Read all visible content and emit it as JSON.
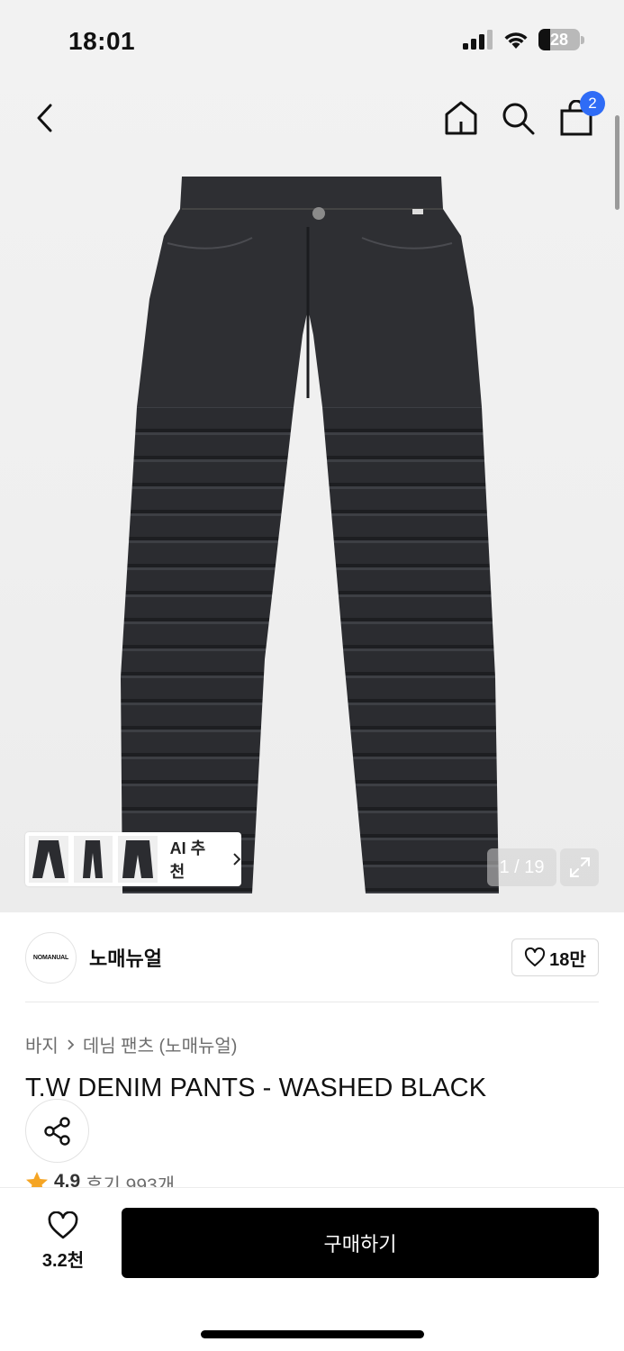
{
  "status_bar": {
    "time": "18:01",
    "battery": "28"
  },
  "nav": {
    "cart_count": "2"
  },
  "gallery": {
    "ai_label": "AI 추천",
    "counter": "1 / 19"
  },
  "brand": {
    "logo_text": "NOMANUAL",
    "name": "노매뉴얼",
    "likes": "18만"
  },
  "breadcrumb": {
    "category": "바지",
    "subcategory": "데님 팬츠 (노매뉴얼)"
  },
  "product": {
    "title": "T.W DENIM PANTS - WASHED BLACK",
    "rating": "4.9",
    "reviews": "후기 993개"
  },
  "bottom_bar": {
    "wish_count": "3.2천",
    "buy_label": "구매하기"
  },
  "colors": {
    "accent_badge": "#2f6cf6",
    "buy_button": "#000000",
    "star": "#f5a524",
    "denim": "#2b2c30"
  },
  "icons": [
    "back-arrow-icon",
    "home-icon",
    "search-icon",
    "bag-icon",
    "chevron-right-icon",
    "expand-icon",
    "heart-icon",
    "share-icon",
    "star-icon",
    "signal-icon",
    "wifi-icon",
    "battery-icon"
  ]
}
